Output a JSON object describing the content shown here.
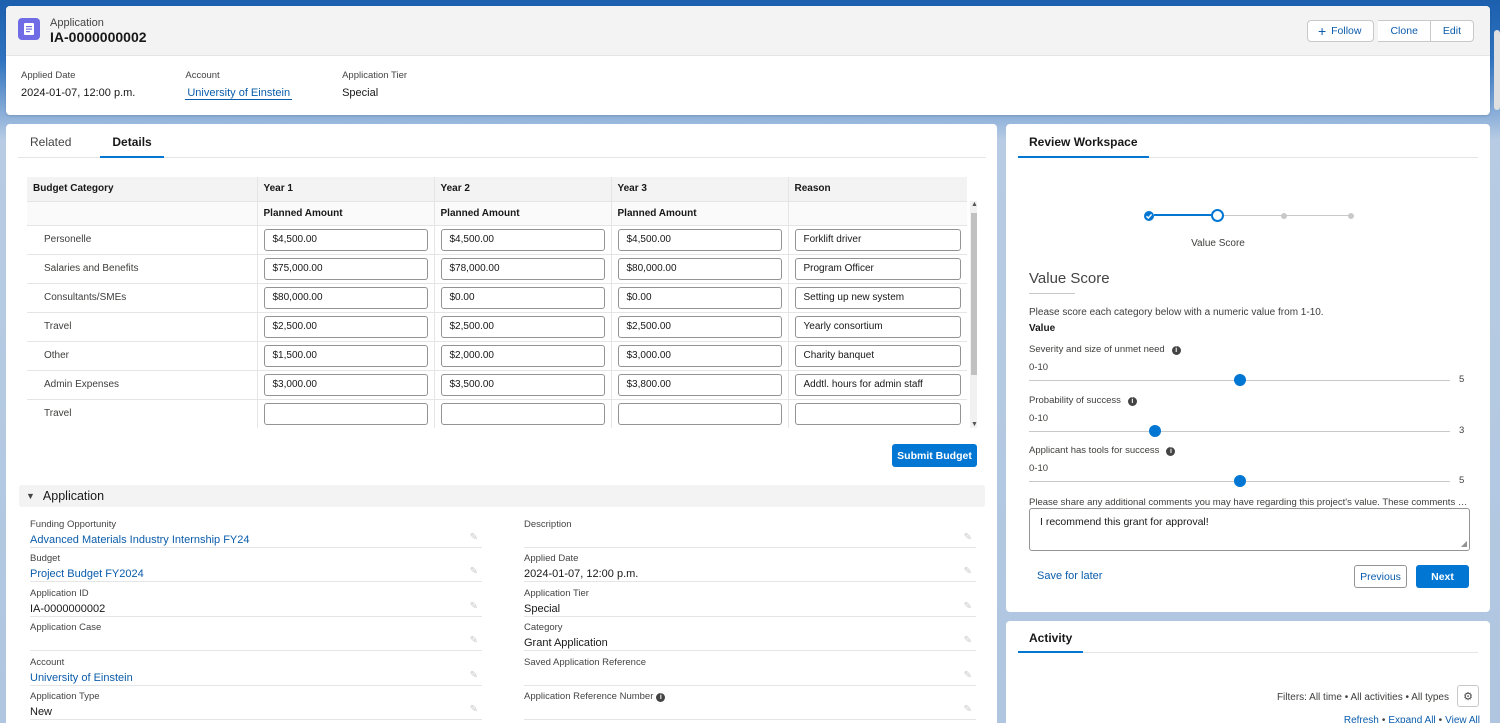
{
  "header": {
    "object_label": "Application",
    "record_title": "IA-0000000002",
    "buttons": {
      "follow": "Follow",
      "clone": "Clone",
      "edit": "Edit"
    },
    "highlights": [
      {
        "label": "Applied Date",
        "value": "2024-01-07, 12:00 p.m.",
        "link": false
      },
      {
        "label": "Account",
        "value": "University of Einstein",
        "link": true
      },
      {
        "label": "Application Tier",
        "value": "Special",
        "link": false
      }
    ]
  },
  "tabs": {
    "related": "Related",
    "details": "Details"
  },
  "budget": {
    "headers": [
      "Budget Category",
      "Year 1",
      "Year 2",
      "Year 3",
      "Reason"
    ],
    "subheader": "Planned Amount",
    "rows": [
      {
        "category": "Personelle",
        "y1": "$4,500.00",
        "y2": "$4,500.00",
        "y3": "$4,500.00",
        "reason": "Forklift driver"
      },
      {
        "category": "Salaries and Benefits",
        "y1": "$75,000.00",
        "y2": "$78,000.00",
        "y3": "$80,000.00",
        "reason": "Program Officer"
      },
      {
        "category": "Consultants/SMEs",
        "y1": "$80,000.00",
        "y2": "$0.00",
        "y3": "$0.00",
        "reason": "Setting up new system"
      },
      {
        "category": "Travel",
        "y1": "$2,500.00",
        "y2": "$2,500.00",
        "y3": "$2,500.00",
        "reason": "Yearly consortium"
      },
      {
        "category": "Other",
        "y1": "$1,500.00",
        "y2": "$2,000.00",
        "y3": "$3,000.00",
        "reason": "Charity banquet"
      },
      {
        "category": "Admin Expenses",
        "y1": "$3,000.00",
        "y2": "$3,500.00",
        "y3": "$3,800.00",
        "reason": "Addtl. hours for admin staff"
      },
      {
        "category": "Travel",
        "y1": "",
        "y2": "",
        "y3": "",
        "reason": ""
      }
    ],
    "submit_label": "Submit Budget"
  },
  "application_section": {
    "title": "Application",
    "left": [
      {
        "label": "Funding Opportunity",
        "value": "Advanced Materials Industry Internship FY24",
        "link": true
      },
      {
        "label": "Budget",
        "value": "Project Budget FY2024",
        "link": true
      },
      {
        "label": "Application ID",
        "value": "IA-0000000002",
        "link": false
      },
      {
        "label": "Application Case",
        "value": "",
        "link": false
      },
      {
        "label": "Account",
        "value": "University of Einstein",
        "link": true
      },
      {
        "label": "Application Type",
        "value": "New",
        "link": false
      }
    ],
    "right": [
      {
        "label": "Description",
        "value": "",
        "link": false
      },
      {
        "label": "Applied Date",
        "value": "2024-01-07, 12:00 p.m.",
        "link": false
      },
      {
        "label": "Application Tier",
        "value": "Special",
        "link": false
      },
      {
        "label": "Category",
        "value": "Grant Application",
        "link": false
      },
      {
        "label": "Saved Application Reference",
        "value": "",
        "link": false
      },
      {
        "label": "Application Reference Number",
        "value": "",
        "link": false,
        "info": true
      }
    ]
  },
  "review": {
    "tab": "Review Workspace",
    "step_label": "Value Score",
    "title": "Value Score",
    "instructions": "Please score each category below with a numeric value from 1-10.",
    "value_label": "Value",
    "questions": [
      {
        "label": "Severity and size of unmet need",
        "range": "0-10",
        "value": "5",
        "fraction": 0.5
      },
      {
        "label": "Probability of success",
        "range": "0-10",
        "value": "3",
        "fraction": 0.3
      },
      {
        "label": "Applicant has tools for success",
        "range": "0-10",
        "value": "5",
        "fraction": 0.5
      }
    ],
    "comments_label": "Please share any additional comments you may have regarding this project's value. These comments will be shared with the applicant.",
    "comments_value": "I recommend this grant for approval!",
    "save_later": "Save for later",
    "previous": "Previous",
    "next": "Next"
  },
  "activity": {
    "tab": "Activity",
    "filters": "Filters: All time • All activities • All types",
    "links": [
      "Refresh",
      "Expand All",
      "View All"
    ]
  },
  "colors": {
    "brand": "#0176d3",
    "link": "#0b5cab",
    "record_icon": "#6f6ce6"
  }
}
